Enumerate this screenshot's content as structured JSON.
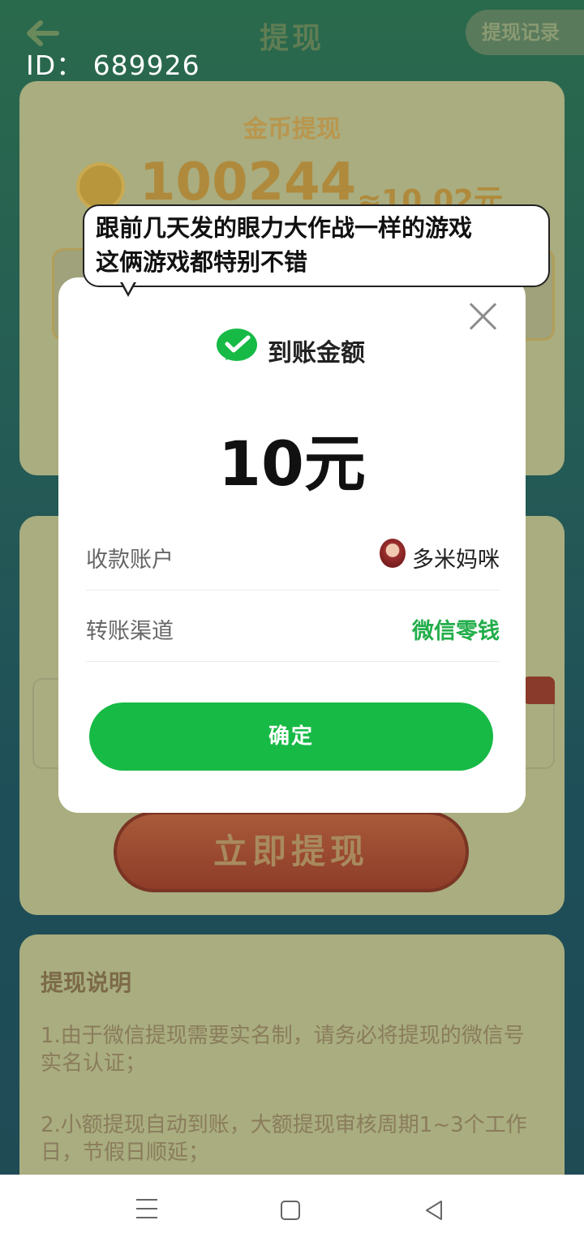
{
  "app": {
    "title": "提现",
    "record_button": "提现记录",
    "id_label": "ID：  689926"
  },
  "coin_card": {
    "title": "金币提现",
    "coin_amount": "100244",
    "approx_value": "≈10.02元"
  },
  "withdraw_button": "立即提现",
  "notes": {
    "title": "提现说明",
    "items": [
      "1.由于微信提现需要实名制，请务必将提现的微信号实名认证；",
      "2.小额提现自动到账，大额提现审核周期1~3个工作日，节假日顺延；"
    ]
  },
  "bubble": {
    "line1": "跟前几天发的眼力大作战一样的游戏",
    "line2": "这俩游戏都特别不错"
  },
  "modal": {
    "heading": "到账金额",
    "amount": "10元",
    "rows": [
      {
        "label": "收款账户",
        "value": "多米妈咪"
      },
      {
        "label": "转账渠道",
        "value": "微信零钱"
      }
    ],
    "confirm_label": "确定"
  },
  "colors": {
    "wechat_green": "#17ba45",
    "channel_green": "#22ad4a"
  }
}
